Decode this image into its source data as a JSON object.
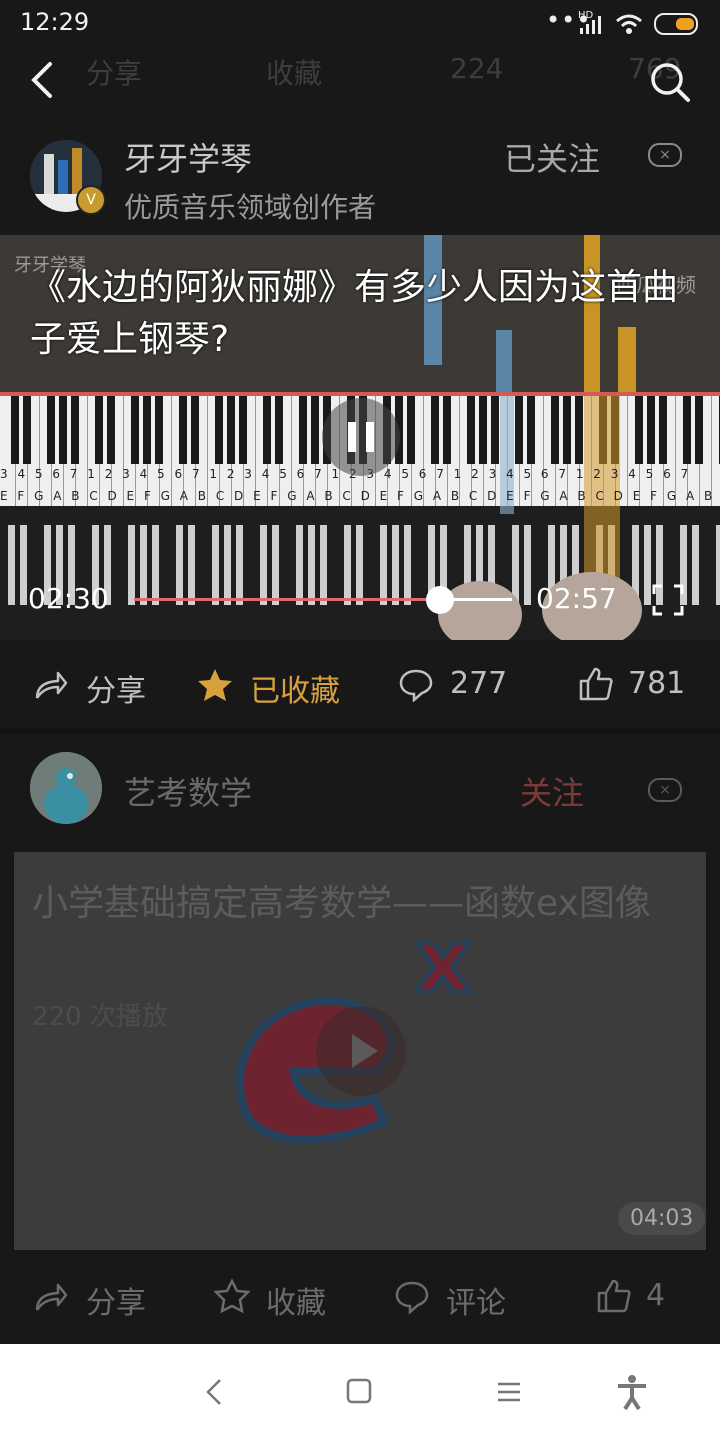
{
  "status_bar": {
    "time": "12:29",
    "network": "HD"
  },
  "ghost_bar": {
    "share": "分享",
    "favorite": "收藏",
    "comments": "224",
    "likes": "769"
  },
  "post1": {
    "author": "牙牙学琴",
    "author_subtitle": "优质音乐领域创作者",
    "follow_label": "已关注",
    "video_title": "《水边的阿狄丽娜》有多少人因为这首曲子爱上钢琴?",
    "watermark_left": "牙牙学琴",
    "watermark_right": "西瓜视频",
    "current_time": "02:30",
    "duration": "02:57",
    "progress": 0.81,
    "share_label": "分享",
    "favorite_label": "已收藏",
    "comment_count": "277",
    "like_count": "781",
    "key_notes": "3 4 5 6 7 1 2 3 4 5 6 7 1 2 3 4 5 6 7 1 2 3 4 5 6 7 1 2 3 4 5 6 7 1 2 3 4 5 6 7",
    "key_letters": "E F G A B C D E F G A B C D E F G A B C D E F G A B C D E F G A B C D E F G A B"
  },
  "post2": {
    "author": "艺考数学",
    "follow_label": "关注",
    "video_title": "小学基础搞定高考数学——函数ex图像",
    "play_count": "220 次播放",
    "duration": "04:03",
    "share_label": "分享",
    "favorite_label": "收藏",
    "comment_label": "评论",
    "like_count": "4"
  },
  "colors": {
    "accent_gold": "#d8a13e",
    "follow_red": "#7e3a3a",
    "progress_red": "#e06a6a"
  }
}
